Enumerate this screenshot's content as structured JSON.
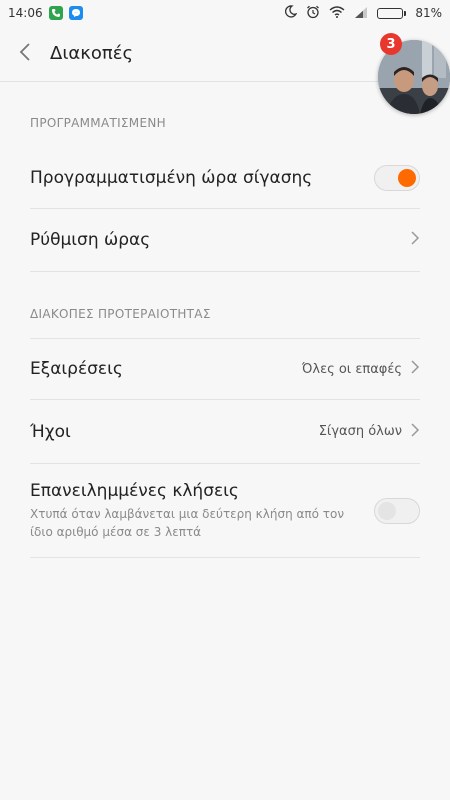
{
  "status_bar": {
    "time": "14:06",
    "battery": "81%",
    "battery_level": 0.81,
    "left_icons": [
      "phone-icon",
      "messenger-icon"
    ],
    "right_icons": [
      "moon-icon",
      "alarm-icon",
      "wifi-icon",
      "signal-icon",
      "battery-icon"
    ]
  },
  "header": {
    "title": "Διακοπές",
    "back_icon": "chevron-left-icon"
  },
  "chat_bubble": {
    "badge_count": "3"
  },
  "sections": {
    "scheduled": "ΠΡΟΓΡΑΜΜΑΤΙΣΜΕΝΗ",
    "priority": "ΔΙΑΚΟΠΕΣ ΠΡΟΤΕΡΑΙΟΤΗΤΑΣ"
  },
  "rows": {
    "scheduled_quiet": {
      "label": "Προγραμματισμένη ώρα σίγασης",
      "enabled": true
    },
    "time_setting": {
      "label": "Ρύθμιση ώρας"
    },
    "exceptions": {
      "label": "Εξαιρέσεις",
      "value": "Όλες οι επαφές"
    },
    "sounds": {
      "label": "Ήχοι",
      "value": "Σίγαση όλων"
    },
    "repeated_calls": {
      "label": "Επανειλημμένες κλήσεις",
      "description": "Χτυπά όταν λαμβάνεται μια δεύτερη κλήση από τον ίδιο αριθμό μέσα σε 3 λεπτά",
      "enabled": false
    }
  },
  "colors": {
    "accent": "#ff6a00",
    "badge": "#e8372c",
    "background": "#f7f7f7"
  }
}
